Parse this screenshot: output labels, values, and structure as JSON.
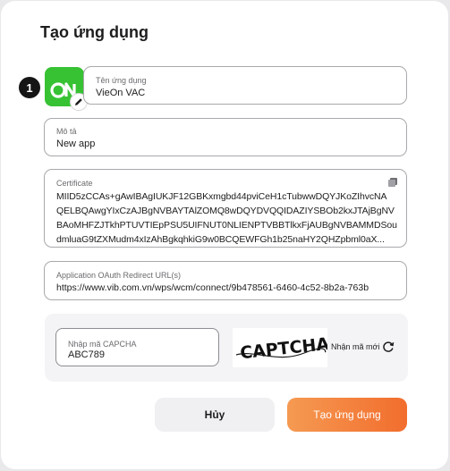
{
  "dialog": {
    "title": "Tạo ứng dụng",
    "step_number": "1",
    "logo_text": "ON"
  },
  "fields": {
    "app_name": {
      "label": "Tên ứng dụng",
      "value": "VieOn VAC"
    },
    "description": {
      "label": "Mô tả",
      "value": "New app"
    },
    "certificate": {
      "label": "Certificate",
      "lines": [
        "MIID5zCCAs+gAwIBAgIUKJF12GBKxmgbd44pviCeH1cTubwwDQYJKoZIhvcNA",
        "QELBQAwgYIxCzAJBgNVBAYTAlZOMQ8wDQYDVQQIDAZIYSBOb2kxJTAjBgNV",
        "BAoMHFZJTkhPTUVTIEpPSU5UIFNUT0NLIENPTVBBTlkxFjAUBgNVBAMMDSou",
        "dmluaG9tZXMudm4xIzAhBgkqhkiG9w0BCQEWFGh1b25naHY2QHZpbml0aX..."
      ]
    },
    "redirect_url": {
      "label": "Application OAuth Redirect URL(s)",
      "value": "https://www.vib.com.vn/wps/wcm/connect/9b478561-6460-4c52-8b2a-763b"
    }
  },
  "captcha": {
    "label": "Nhập mã CAPCHA",
    "value": "ABC789",
    "image_text": "CAPTCHA",
    "refresh_label": "Nhận mã mới"
  },
  "buttons": {
    "cancel": "Hủy",
    "create": "Tạo ứng dụng"
  },
  "colors": {
    "logo_green": "#37c233",
    "primary_gradient_start": "#f59a52",
    "primary_gradient_end": "#f26d2d"
  }
}
